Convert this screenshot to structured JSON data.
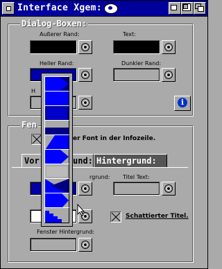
{
  "window": {
    "title": "Interface Xgem:"
  },
  "dialog_group": {
    "title": "Dialog-Boxen:",
    "outer_border_label": "Außerer Rand:",
    "text_label": "Text:",
    "light_border_label": "Heller Rand:",
    "dark_border_label": "Dunkler Rand:",
    "partial_label": "H",
    "info_glyph": "i"
  },
  "window_group": {
    "title_partial": "Fen",
    "font_option_partial": "er Font in der Infozeile.",
    "tabs": [
      {
        "label": "Vor",
        "active": false
      },
      {
        "label": "und:",
        "active": false
      },
      {
        "label": "Hintergrund:",
        "active": true
      }
    ],
    "background_partial": "rgrund:",
    "title_text_label": "Titel Text:",
    "shaded_title_label": "Schattierter Titel.",
    "window_background_label": "Fenster Hintergrund:"
  },
  "swatches": {
    "outer_border": "#000000",
    "text": "#000000",
    "light_border": "#0000aa",
    "dark_border": "#aaaaaa",
    "partial_row": "#aaaaaa",
    "background": "#0000aa",
    "title_text": "#aaaaaa",
    "lower_left": "#ffffff",
    "window_background": "#aaaaaa"
  },
  "colors": {
    "titlebar": "#00009c",
    "pattern_blue": "#0000ff",
    "pattern_dark": "#000080"
  },
  "popup": {
    "pattern_count": 10
  }
}
